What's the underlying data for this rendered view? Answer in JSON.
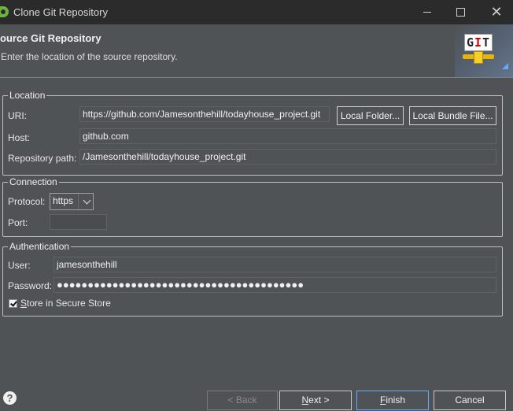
{
  "window": {
    "title": "Clone Git Repository",
    "minimize_glyph": "",
    "close_glyph": "✕"
  },
  "header": {
    "title": "ource Git Repository",
    "description": "Enter the location of the source repository.",
    "logo_text": "GIT"
  },
  "location": {
    "legend": "Location",
    "uri_label": "URI:",
    "uri_value": "https://github.com/Jamesonthehill/todayhouse_project.git",
    "local_folder_button": "Local Folder...",
    "local_bundle_button": "Local Bundle File...",
    "host_label": "Host:",
    "host_value": "github.com",
    "repo_path_label": "Repository path:",
    "repo_path_value": "/Jamesonthehill/todayhouse_project.git"
  },
  "connection": {
    "legend": "Connection",
    "protocol_label": "Protocol:",
    "protocol_value": "https",
    "port_label": "Port:",
    "port_value": ""
  },
  "authentication": {
    "legend": "Authentication",
    "user_label": "User:",
    "user_value": "jamesonthehill",
    "password_label": "Password:",
    "password_mask": "●●●●●●●●●●●●●●●●●●●●●●●●●●●●●●●●●●●●●●●●",
    "store_label_mnemonic": "S",
    "store_label_rest": "tore in Secure Store",
    "store_checked": true
  },
  "footer": {
    "help_glyph": "?",
    "back_label": "< Back",
    "next_mnemonic": "N",
    "next_rest": "ext >",
    "finish_mnemonic": "F",
    "finish_rest": "inish",
    "cancel_label": "Cancel"
  },
  "colors": {
    "background": "#4f5356",
    "titlebar": "#2b2b2b",
    "accent": "#6aa7ff"
  }
}
